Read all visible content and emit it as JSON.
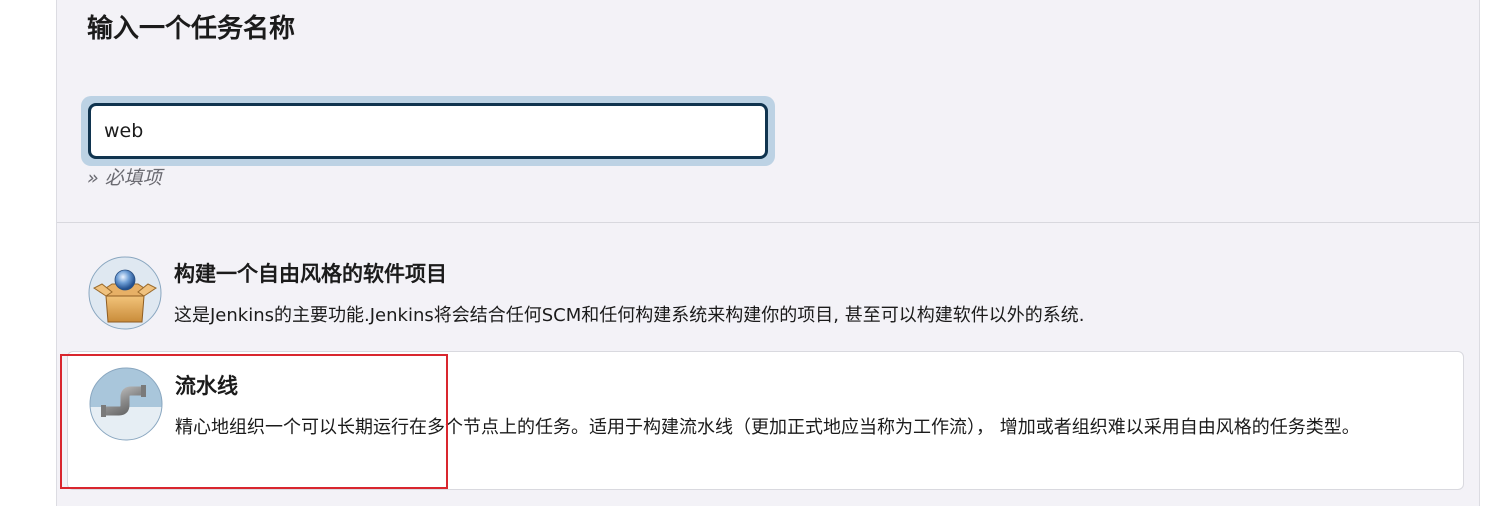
{
  "form": {
    "title": "输入一个任务名称",
    "name_input_value": "web",
    "required_hint": "» 必填项"
  },
  "item_types": [
    {
      "title": "构建一个自由风格的软件项目",
      "description": "这是Jenkins的主要功能.Jenkins将会结合任何SCM和任何构建系统来构建你的项目, 甚至可以构建软件以外的系统.",
      "icon": "freestyle-box-icon"
    },
    {
      "title": "流水线",
      "description": "精心地组织一个可以长期运行在多个节点上的任务。适用于构建流水线（更加正式地应当称为工作流）， 增加或者组织难以采用自由风格的任务类型。",
      "icon": "pipeline-pipe-icon"
    }
  ],
  "colors": {
    "panel_background": "#f3f2f7",
    "input_border": "#10344f",
    "focus_ring": "#bcd2e4",
    "highlight_border": "#d9262e"
  }
}
